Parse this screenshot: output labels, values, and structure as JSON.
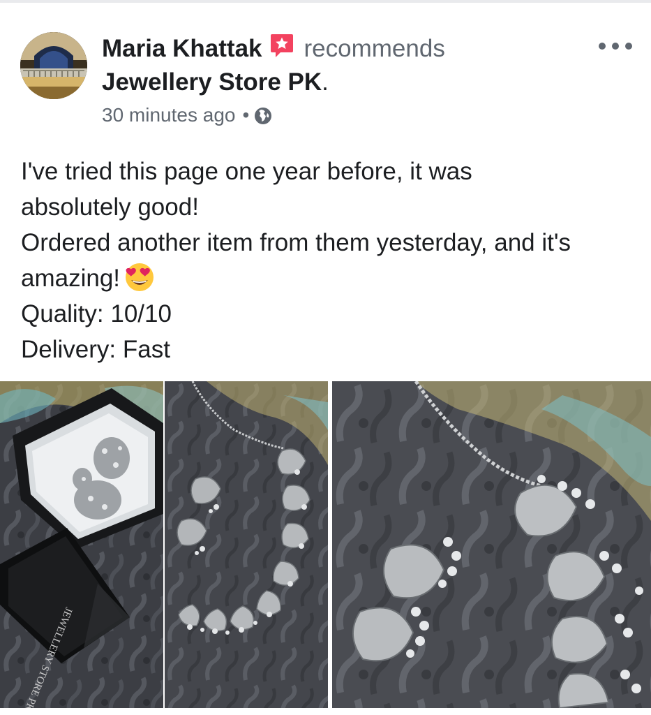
{
  "post": {
    "author": "Maria Khattak",
    "action": "recommends",
    "page_name": "Jewellery Store PK",
    "page_suffix": ".",
    "time": "30 minutes ago",
    "separator": "•",
    "privacy_icon": "globe-icon",
    "recommend_icon": "recommend-star-icon",
    "menu_icon": "more-options-icon",
    "text_lines": [
      "I've tried this page one year before, it was",
      "absolutely good!",
      "Ordered another item from them yesterday, and it's",
      "amazing!",
      "Quality: 10/10",
      "Delivery: Fast"
    ],
    "emoji": "heart-eyes-emoji",
    "box_brand_text": "JEWELLERY STORE PK"
  },
  "colors": {
    "text_primary": "#1c1e21",
    "text_secondary": "#606770",
    "recommend_badge": "#f3425f",
    "emoji_yellow": "#ffc83d",
    "emoji_heart": "#e0245e"
  }
}
